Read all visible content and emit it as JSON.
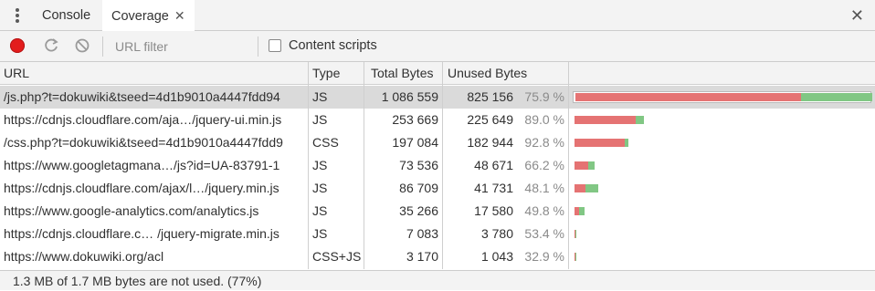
{
  "tabs": {
    "console": "Console",
    "coverage": "Coverage",
    "tab_close": "✕",
    "panel_close": "✕"
  },
  "toolbar": {
    "filter_placeholder": "URL filter",
    "content_scripts_label": "Content scripts",
    "content_scripts_checked": false
  },
  "table": {
    "headers": {
      "url": "URL",
      "type": "Type",
      "total": "Total Bytes",
      "unused": "Unused Bytes"
    },
    "rows": [
      {
        "url": "/js.php?t=dokuwiki&tseed=4d1b9010a4447fdd94",
        "type": "JS",
        "total": "1 086 559",
        "unused": "825 156",
        "pct": "75.9 %",
        "total_bytes": 1086559,
        "unused_bytes": 825156,
        "selected": true
      },
      {
        "url": "https://cdnjs.cloudflare.com/aja…/jquery-ui.min.js",
        "type": "JS",
        "total": "253 669",
        "unused": "225 649",
        "pct": "89.0 %",
        "total_bytes": 253669,
        "unused_bytes": 225649
      },
      {
        "url": "/css.php?t=dokuwiki&tseed=4d1b9010a4447fdd9",
        "type": "CSS",
        "total": "197 084",
        "unused": "182 944",
        "pct": "92.8 %",
        "total_bytes": 197084,
        "unused_bytes": 182944
      },
      {
        "url": "https://www.googletagmana…/js?id=UA-83791-1",
        "type": "JS",
        "total": "73 536",
        "unused": "48 671",
        "pct": "66.2 %",
        "total_bytes": 73536,
        "unused_bytes": 48671
      },
      {
        "url": "https://cdnjs.cloudflare.com/ajax/l…/jquery.min.js",
        "type": "JS",
        "total": "86 709",
        "unused": "41 731",
        "pct": "48.1 %",
        "total_bytes": 86709,
        "unused_bytes": 41731
      },
      {
        "url": "https://www.google-analytics.com/analytics.js",
        "type": "JS",
        "total": "35 266",
        "unused": "17 580",
        "pct": "49.8 %",
        "total_bytes": 35266,
        "unused_bytes": 17580
      },
      {
        "url": "https://cdnjs.cloudflare.c… /jquery-migrate.min.js",
        "type": "JS",
        "total": "7 083",
        "unused": "3 780",
        "pct": "53.4 %",
        "total_bytes": 7083,
        "unused_bytes": 3780
      },
      {
        "url": "https://www.dokuwiki.org/acl",
        "type": "CSS+JS",
        "total": "3 170",
        "unused": "1 043",
        "pct": "32.9 %",
        "total_bytes": 3170,
        "unused_bytes": 1043
      }
    ]
  },
  "footer": {
    "summary": "1.3 MB of 1.7 MB bytes are not used. (77%)"
  },
  "colors": {
    "unused": "#e57373",
    "used": "#81c784",
    "record": "#e31c1c"
  }
}
